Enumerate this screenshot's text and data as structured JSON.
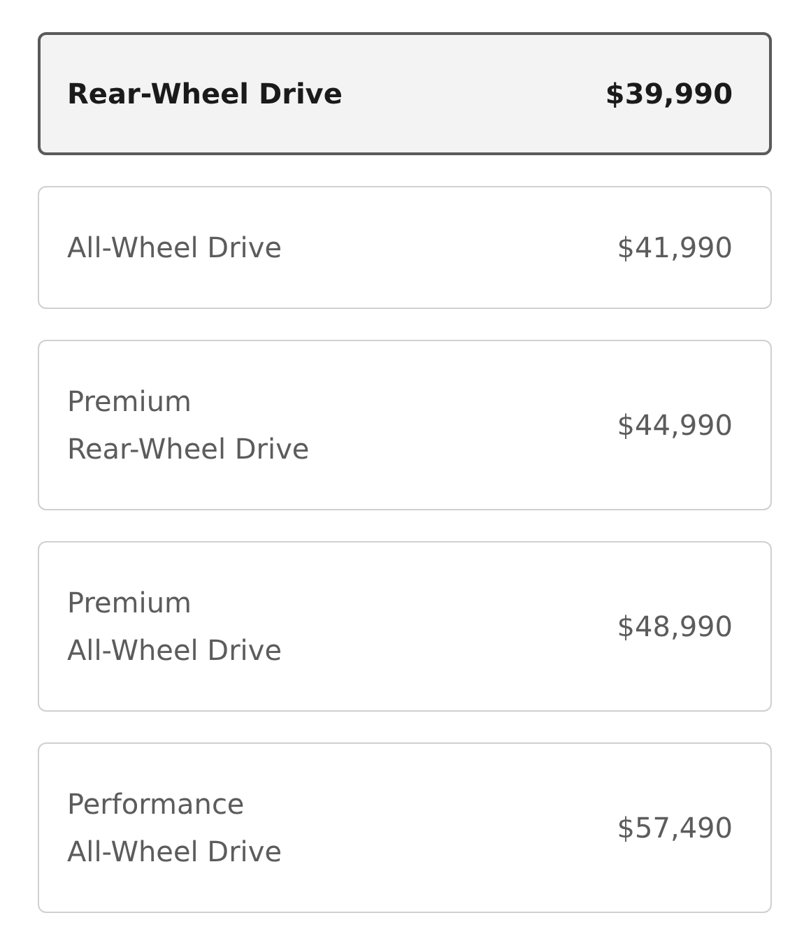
{
  "options": [
    {
      "lines": [
        "Rear-Wheel Drive"
      ],
      "price": "$39,990",
      "selected": true
    },
    {
      "lines": [
        "All-Wheel Drive"
      ],
      "price": "$41,990",
      "selected": false
    },
    {
      "lines": [
        "Premium",
        "Rear-Wheel Drive"
      ],
      "price": "$44,990",
      "selected": false
    },
    {
      "lines": [
        "Premium",
        "All-Wheel Drive"
      ],
      "price": "$48,990",
      "selected": false
    },
    {
      "lines": [
        "Performance",
        "All-Wheel Drive"
      ],
      "price": "$57,490",
      "selected": false
    }
  ]
}
